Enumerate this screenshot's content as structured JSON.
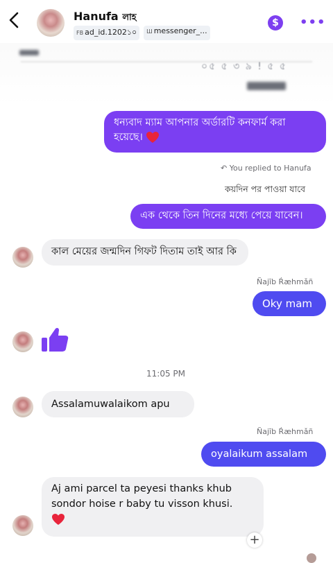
{
  "header": {
    "name": "Hanufa",
    "name_suffix": "লাহ",
    "tag1_prefix": "FB",
    "tag1": "ad_id.1202",
    "tag1_tail": "১০",
    "tag2_prefix": "Ш",
    "tag2": "messenger_..."
  },
  "blurred": {
    "text": "০৫ ৫ ৩ ৯ ! ৫ ৫"
  },
  "messages": {
    "m1": "ধন্যবাদ ম্যাম আপনার অর্ডারটি কনফার্ম করা হয়েছে।",
    "reply_note": "You replied to Hanufa",
    "reply_quote": "কয়দিন পর পাওয়া যাবে",
    "m2": "এক থেকে তিন দিনের মধ্যে পেয়ে যাবেন।",
    "m3": "কাল মেয়ের জন্মদিন গিফট দিতাম তাই আর কি",
    "sender1": "Ñajīb Ŕæhmǎñ",
    "m4": "Oky mam",
    "time": "11:05 PM",
    "m5": "Assalamuwalaikom apu",
    "sender2": "Ñajīb Ŕæhmǎñ",
    "m6": "oyalaikum assalam",
    "m7": "Aj ami parcel ta peyesi thanks khub sondor hoise r baby tu visson khusi."
  },
  "icons": {
    "back": "chevron-left-icon",
    "dollar": "dollar-icon",
    "more": "more-icon",
    "thumb": "thumbs-up-icon",
    "heart": "heart-icon",
    "plus": "plus-icon"
  },
  "colors": {
    "accent_purple": "#7b3ff2",
    "accent_blue": "#4f4bf0",
    "incoming_bg": "#f0f0f2",
    "heart_red": "#e8243b"
  }
}
